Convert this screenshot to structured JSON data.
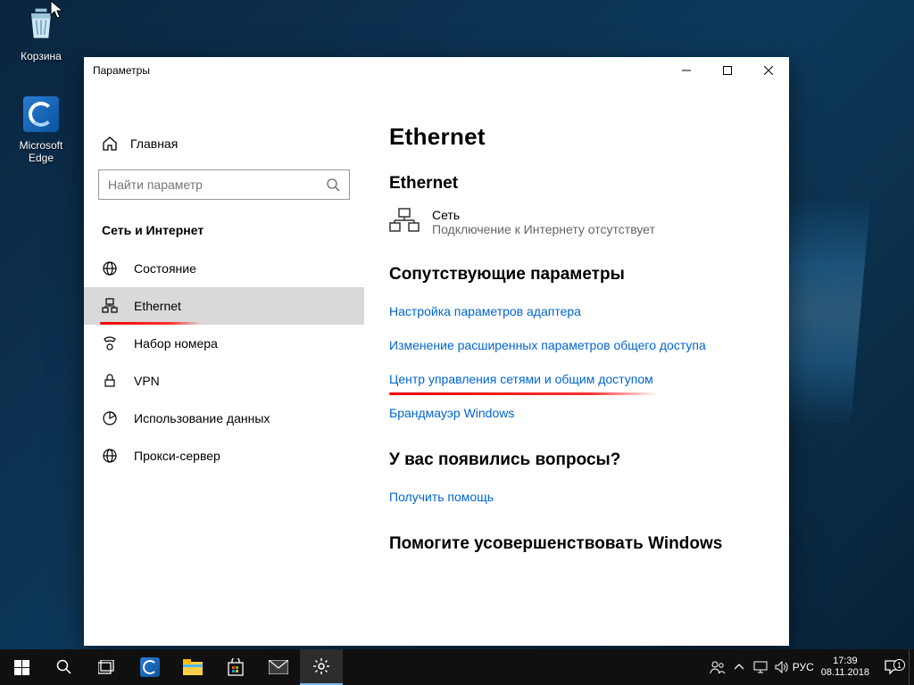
{
  "desktop": {
    "recycle": "Корзина",
    "edge": "Microsoft Edge"
  },
  "window": {
    "title": "Параметры",
    "home": "Главная",
    "search_placeholder": "Найти параметр",
    "section": "Сеть и Интернет",
    "nav": [
      {
        "icon": "status",
        "label": "Состояние"
      },
      {
        "icon": "ethernet",
        "label": "Ethernet",
        "active": true,
        "highlight": true
      },
      {
        "icon": "dialup",
        "label": "Набор номера"
      },
      {
        "icon": "vpn",
        "label": "VPN"
      },
      {
        "icon": "datausage",
        "label": "Использование данных"
      },
      {
        "icon": "proxy",
        "label": "Прокси-сервер"
      }
    ]
  },
  "content": {
    "h1": "Ethernet",
    "h2_net": "Ethernet",
    "net_name": "Сеть",
    "net_status": "Подключение к Интернету отсутствует",
    "related_heading": "Сопутствующие параметры",
    "links": [
      {
        "text": "Настройка параметров адаптера"
      },
      {
        "text": "Изменение расширенных параметров общего доступа"
      },
      {
        "text": "Центр управления сетями и общим доступом",
        "highlight": true
      },
      {
        "text": "Брандмауэр Windows"
      }
    ],
    "question_heading": "У вас появились вопросы?",
    "help_link": "Получить помощь",
    "improve_heading": "Помогите усовершенствовать Windows"
  },
  "taskbar": {
    "lang": "РУС",
    "time": "17:39",
    "date": "08.11.2018",
    "notifications": "1"
  }
}
